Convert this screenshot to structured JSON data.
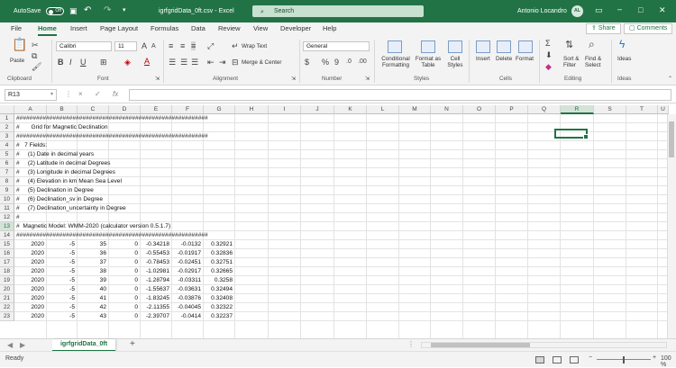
{
  "titlebar": {
    "autosave": "AutoSave",
    "autosave_state": "Off",
    "filename": "igrfgridData_0ft.csv",
    "separator": "-",
    "app": "Excel",
    "search_placeholder": "Search",
    "user": "Antonio Locandro",
    "initials": "AL"
  },
  "tabs": [
    "File",
    "Home",
    "Insert",
    "Page Layout",
    "Formulas",
    "Data",
    "Review",
    "View",
    "Developer",
    "Help"
  ],
  "active_tab": "Home",
  "share_label": "Share",
  "comments_label": "Comments",
  "ribbon": {
    "paste": "Paste",
    "font_name": "Calibri",
    "font_size": "11",
    "wrap_text": "Wrap Text",
    "merge_center": "Merge & Center",
    "number_format": "General",
    "conditional_formatting": [
      "Conditional",
      "Formatting"
    ],
    "format_as_table": [
      "Format as",
      "Table"
    ],
    "cell_styles": [
      "Cell",
      "Styles"
    ],
    "insert": "Insert",
    "delete": "Delete",
    "format": "Format",
    "sort_filter": [
      "Sort &",
      "Filter"
    ],
    "find_select": [
      "Find &",
      "Select"
    ],
    "ideas": "Ideas",
    "groups": [
      "Clipboard",
      "Font",
      "Alignment",
      "Number",
      "Styles",
      "Cells",
      "Editing",
      "Ideas"
    ]
  },
  "formula_bar": {
    "name_box": "R13",
    "fx": "fx",
    "cancel": "×",
    "enter": "✓"
  },
  "grid": {
    "columns": [
      "A",
      "B",
      "C",
      "D",
      "E",
      "F",
      "G",
      "H",
      "I",
      "J",
      "K",
      "L",
      "M",
      "N",
      "O",
      "P",
      "Q",
      "R",
      "S",
      "T",
      "U"
    ],
    "selected_column": "R",
    "selected_row": 13,
    "rows": [
      {
        "n": 1,
        "text": "##########################################################"
      },
      {
        "n": 2,
        "text": "#       Grid for Magnetic Declination"
      },
      {
        "n": 3,
        "text": "##########################################################"
      },
      {
        "n": 4,
        "text": "#   7 Fields:"
      },
      {
        "n": 5,
        "text": "#     (1) Date in decimal years"
      },
      {
        "n": 6,
        "text": "#     (2) Latitude in decimal Degrees"
      },
      {
        "n": 7,
        "text": "#     (3) Longitude in decimal Degrees"
      },
      {
        "n": 8,
        "text": "#     (4) Elevation in km Mean Sea Level"
      },
      {
        "n": 9,
        "text": "#     (5) Declination in Degree"
      },
      {
        "n": 10,
        "text": "#     (6) Declination_sv in Degree"
      },
      {
        "n": 11,
        "text": "#     (7) Declination_uncertainty in Degree"
      },
      {
        "n": 12,
        "text": "#"
      },
      {
        "n": 13,
        "text": "#  Magnetic Model: WMM-2020 (calculator version 0.5.1.7)"
      },
      {
        "n": 14,
        "text": "##########################################################"
      },
      {
        "n": 15,
        "vals": [
          "2020",
          "-5",
          "35",
          "0",
          "-0.34218",
          "-0.0132",
          "0.32921"
        ]
      },
      {
        "n": 16,
        "vals": [
          "2020",
          "-5",
          "36",
          "0",
          "-0.55453",
          "-0.01917",
          "0.32836"
        ]
      },
      {
        "n": 17,
        "vals": [
          "2020",
          "-5",
          "37",
          "0",
          "-0.78453",
          "-0.02451",
          "0.32751"
        ]
      },
      {
        "n": 18,
        "vals": [
          "2020",
          "-5",
          "38",
          "0",
          "-1.02981",
          "-0.02917",
          "0.32665"
        ]
      },
      {
        "n": 19,
        "vals": [
          "2020",
          "-5",
          "39",
          "0",
          "-1.28794",
          "-0.03311",
          "0.3258"
        ]
      },
      {
        "n": 20,
        "vals": [
          "2020",
          "-5",
          "40",
          "0",
          "-1.55637",
          "-0.03631",
          "0.32494"
        ]
      },
      {
        "n": 21,
        "vals": [
          "2020",
          "-5",
          "41",
          "0",
          "-1.83245",
          "-0.03876",
          "0.32408"
        ]
      },
      {
        "n": 22,
        "vals": [
          "2020",
          "-5",
          "42",
          "0",
          "-2.11355",
          "-0.04045",
          "0.32322"
        ]
      },
      {
        "n": 23,
        "vals": [
          "2020",
          "-5",
          "43",
          "0",
          "-2.39707",
          "-0.0414",
          "0.32237"
        ]
      }
    ]
  },
  "sheet": {
    "tab": "igrfgridData_0ft",
    "add": "+"
  },
  "status": {
    "ready": "Ready",
    "zoom": "100 %",
    "minus": "−",
    "plus": "+"
  }
}
